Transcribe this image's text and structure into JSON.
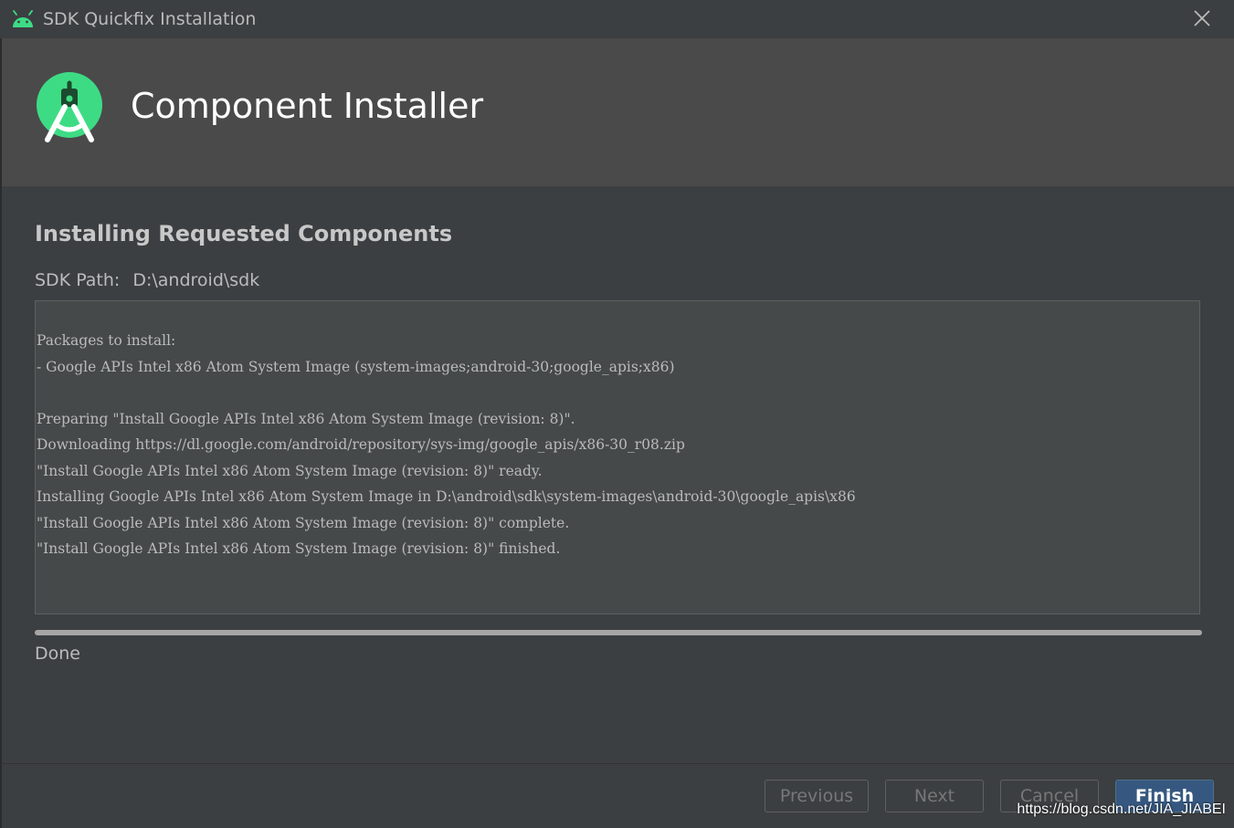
{
  "window": {
    "title": "SDK Quickfix Installation",
    "app_icon": "android-icon",
    "close_icon": "close-icon"
  },
  "banner": {
    "logo": "android-studio-logo",
    "heading": "Component Installer"
  },
  "content": {
    "section_title": "Installing Requested Components",
    "sdk_path_label": "SDK Path:",
    "sdk_path_value": "D:\\android\\sdk",
    "log_lines": [
      "Packages to install:",
      "- Google APIs Intel x86 Atom System Image (system-images;android-30;google_apis;x86)",
      "",
      "Preparing \"Install Google APIs Intel x86 Atom System Image (revision: 8)\".",
      "Downloading https://dl.google.com/android/repository/sys-img/google_apis/x86-30_r08.zip",
      "\"Install Google APIs Intel x86 Atom System Image (revision: 8)\" ready.",
      "Installing Google APIs Intel x86 Atom System Image in D:\\android\\sdk\\system-images\\android-30\\google_apis\\x86",
      "\"Install Google APIs Intel x86 Atom System Image (revision: 8)\" complete.",
      "\"Install Google APIs Intel x86 Atom System Image (revision: 8)\" finished."
    ],
    "progress_percent": 100,
    "status": "Done"
  },
  "footer": {
    "previous_label": "Previous",
    "next_label": "Next",
    "cancel_label": "Cancel",
    "finish_label": "Finish"
  },
  "watermark": "https://blog.csdn.net/JIA_JIABEI",
  "colors": {
    "accent": "#365880",
    "android_green": "#3ddc84",
    "background": "#3c3f41",
    "banner": "#4a4a4a"
  }
}
